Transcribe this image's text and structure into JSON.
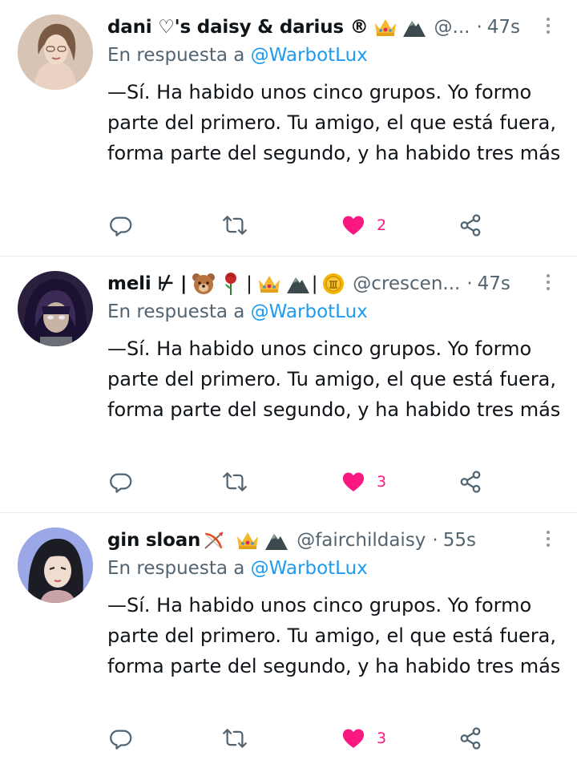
{
  "colors": {
    "accent": "#1d9bf0",
    "like": "#f91880",
    "muted": "#536471"
  },
  "tweets": [
    {
      "name": "dani ♡'s daisy & darius ®",
      "badges": [
        "crown-emoji",
        "mountain-emoji"
      ],
      "handle": "@...",
      "separator": "·",
      "time": "47s",
      "reply_prefix": "En respuesta a",
      "reply_to": "@WarbotLux",
      "text": "—Sí. Ha habido unos cinco grupos. Yo formo parte del primero. Tu amigo, el que está fuera, forma parte del segundo, y ha habido tres más",
      "likes": "2",
      "icons": [
        "reply-icon",
        "retweet-icon",
        "heart-icon",
        "share-icon"
      ]
    },
    {
      "name": "meli ⊬ |",
      "name_parts": [
        "|",
        "|",
        "|"
      ],
      "badges": [
        "bear-emoji",
        "rose-emoji",
        "crown-emoji",
        "mountain-emoji",
        "coin-emoji"
      ],
      "handle": "@crescen...",
      "separator": "·",
      "time": "47s",
      "reply_prefix": "En respuesta a",
      "reply_to": "@WarbotLux",
      "text": "—Sí. Ha habido unos cinco grupos. Yo formo parte del primero. Tu amigo, el que está fuera, forma parte del segundo, y ha habido tres más",
      "likes": "3",
      "icons": [
        "reply-icon",
        "retweet-icon",
        "heart-icon",
        "share-icon"
      ]
    },
    {
      "name": "gin sloan",
      "badges": [
        "bow-and-arrow-emoji",
        "crown-emoji",
        "mountain-emoji"
      ],
      "handle": "@fairchildaisy",
      "separator": "·",
      "time": "55s",
      "reply_prefix": "En respuesta a",
      "reply_to": "@WarbotLux",
      "text": "—Sí. Ha habido unos cinco grupos. Yo formo parte del primero. Tu amigo, el que está fuera, forma parte del segundo, y ha habido tres más",
      "likes": "3",
      "icons": [
        "reply-icon",
        "retweet-icon",
        "heart-icon",
        "share-icon"
      ]
    }
  ]
}
